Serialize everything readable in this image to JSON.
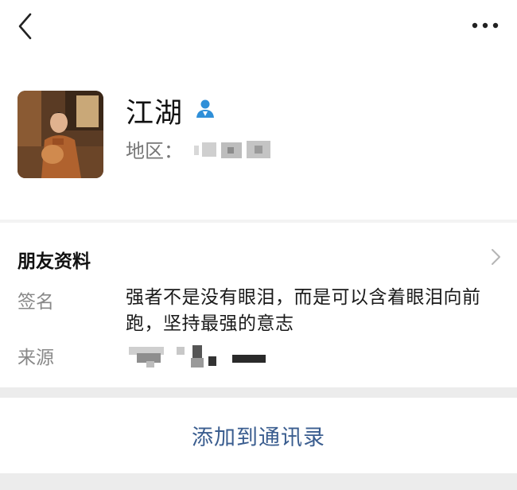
{
  "nav": {
    "back_icon": "chevron-left-icon",
    "more_icon": "more-dots-icon"
  },
  "profile": {
    "name": "江湖",
    "contact_icon": "contact-person-icon",
    "region_label": "地区：",
    "accent_color": "#2f8fd8"
  },
  "section": {
    "title": "朋友资料",
    "chevron_icon": "chevron-right-icon"
  },
  "rows": {
    "signature_label": "签名",
    "signature_text": "强者不是没有眼泪，而是可以含着眼泪向前跑，坚持最强的意志",
    "source_label": "来源"
  },
  "action": {
    "add_to_contacts": "添加到通讯录",
    "color": "#3a5d8f"
  }
}
